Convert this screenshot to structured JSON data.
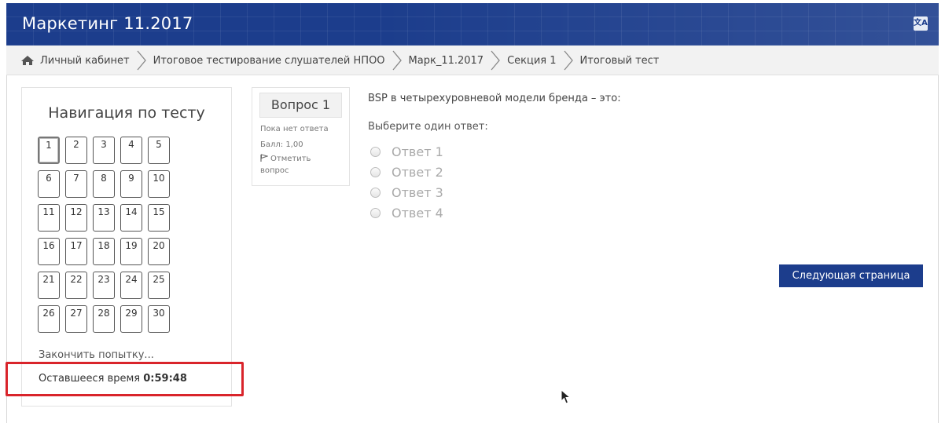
{
  "header": {
    "site_title": "Маркетинг 11.2017",
    "lang_icon": "translate-icon",
    "lang_icon_glyph": "文A",
    "bg_color": "#1c3d8c"
  },
  "breadcrumb": {
    "home_icon": "home-icon",
    "items": [
      "Личный кабинет",
      "Итоговое тестирование слушателей НПОО",
      "Марк_11.2017",
      "Секция 1",
      "Итоговый тест"
    ]
  },
  "navigation": {
    "title": "Навигация по тесту",
    "questions": [
      "1",
      "2",
      "3",
      "4",
      "5",
      "6",
      "7",
      "8",
      "9",
      "10",
      "11",
      "12",
      "13",
      "14",
      "15",
      "16",
      "17",
      "18",
      "19",
      "20",
      "21",
      "22",
      "23",
      "24",
      "25",
      "26",
      "27",
      "28",
      "29",
      "30"
    ],
    "current": "1",
    "finish_label": "Закончить попытку...",
    "timer_label": "Оставшееся время",
    "timer_value": "0:59:48",
    "highlight_color": "#d9242b"
  },
  "question_info": {
    "number_label": "Вопрос 1",
    "state": "Пока нет ответа",
    "grade": "Балл: 1,00",
    "flag_icon": "flag-icon",
    "flag_label": "Отметить вопрос"
  },
  "question": {
    "text": "BSP в четырехуровневой модели бренда – это:",
    "prompt": "Выберите один ответ:",
    "answers": [
      "Ответ 1",
      "Ответ 2",
      "Ответ 3",
      "Ответ 4"
    ]
  },
  "actions": {
    "next_label": "Следующая страница",
    "button_color": "#1c3d8c"
  }
}
